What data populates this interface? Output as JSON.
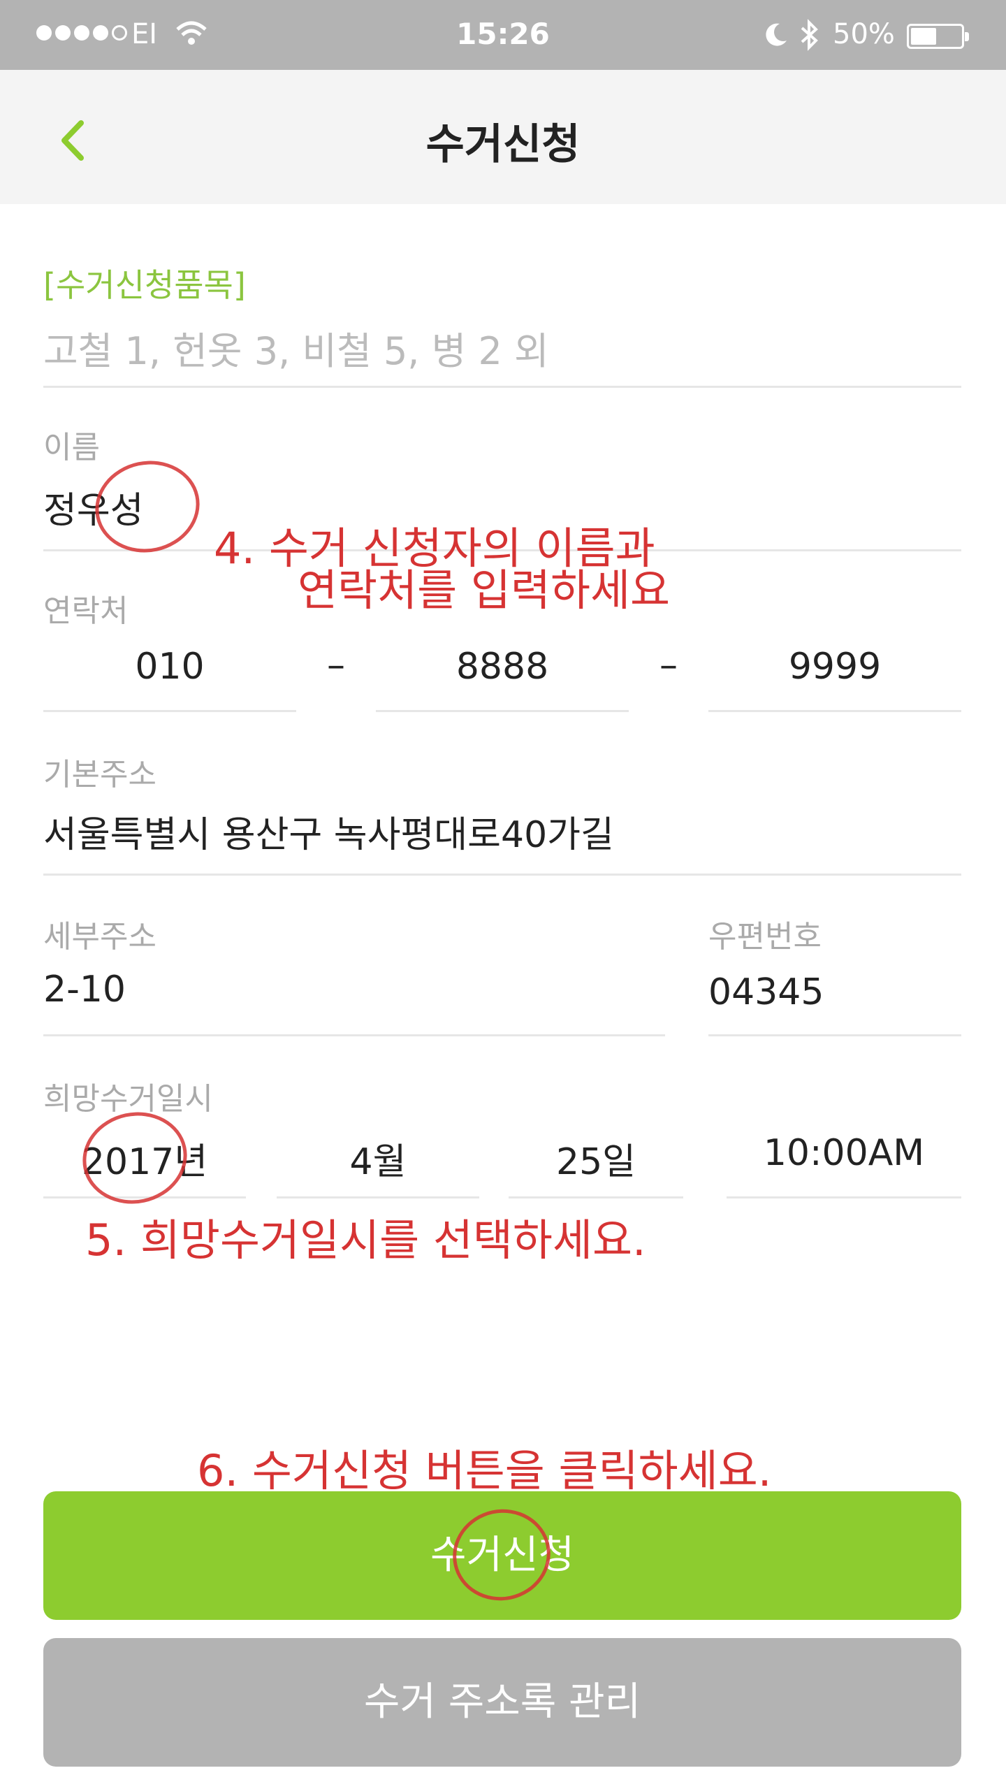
{
  "status_bar": {
    "carrier": "EI",
    "time": "15:26",
    "battery_percent": "50%"
  },
  "header": {
    "title": "수거신청"
  },
  "form": {
    "items": {
      "label": "[수거신청품목]",
      "value": "고철 1, 헌옷 3, 비철 5, 병 2 외"
    },
    "name": {
      "label": "이름",
      "value": "정우성"
    },
    "phone": {
      "label": "연락처",
      "part1": "010",
      "part2": "8888",
      "part3": "9999",
      "separator": "–"
    },
    "address": {
      "label": "기본주소",
      "value": "서울특별시 용산구 녹사평대로40가길"
    },
    "detail_address": {
      "label": "세부주소",
      "value": "2-10"
    },
    "postal_code": {
      "label": "우편번호",
      "value": "04345"
    },
    "pickup_datetime": {
      "label": "희망수거일시",
      "year": "2017년",
      "month": "4월",
      "day": "25일",
      "time": "10:00AM"
    }
  },
  "annotations": {
    "step4_line1": "4. 수거 신청자의 이름과",
    "step4_line2": "연락처를 입력하세요",
    "step5": "5. 희망수거일시를 선택하세요.",
    "step6": "6. 수거신청 버튼을 클릭하세요."
  },
  "buttons": {
    "submit": "수거신청",
    "address_book": "수거 주소록 관리"
  },
  "colors": {
    "accent": "#8dcc2f",
    "status_bar": "#b3b3b3",
    "annotation": "#d63333",
    "secondary_button": "#b3b3b3"
  }
}
